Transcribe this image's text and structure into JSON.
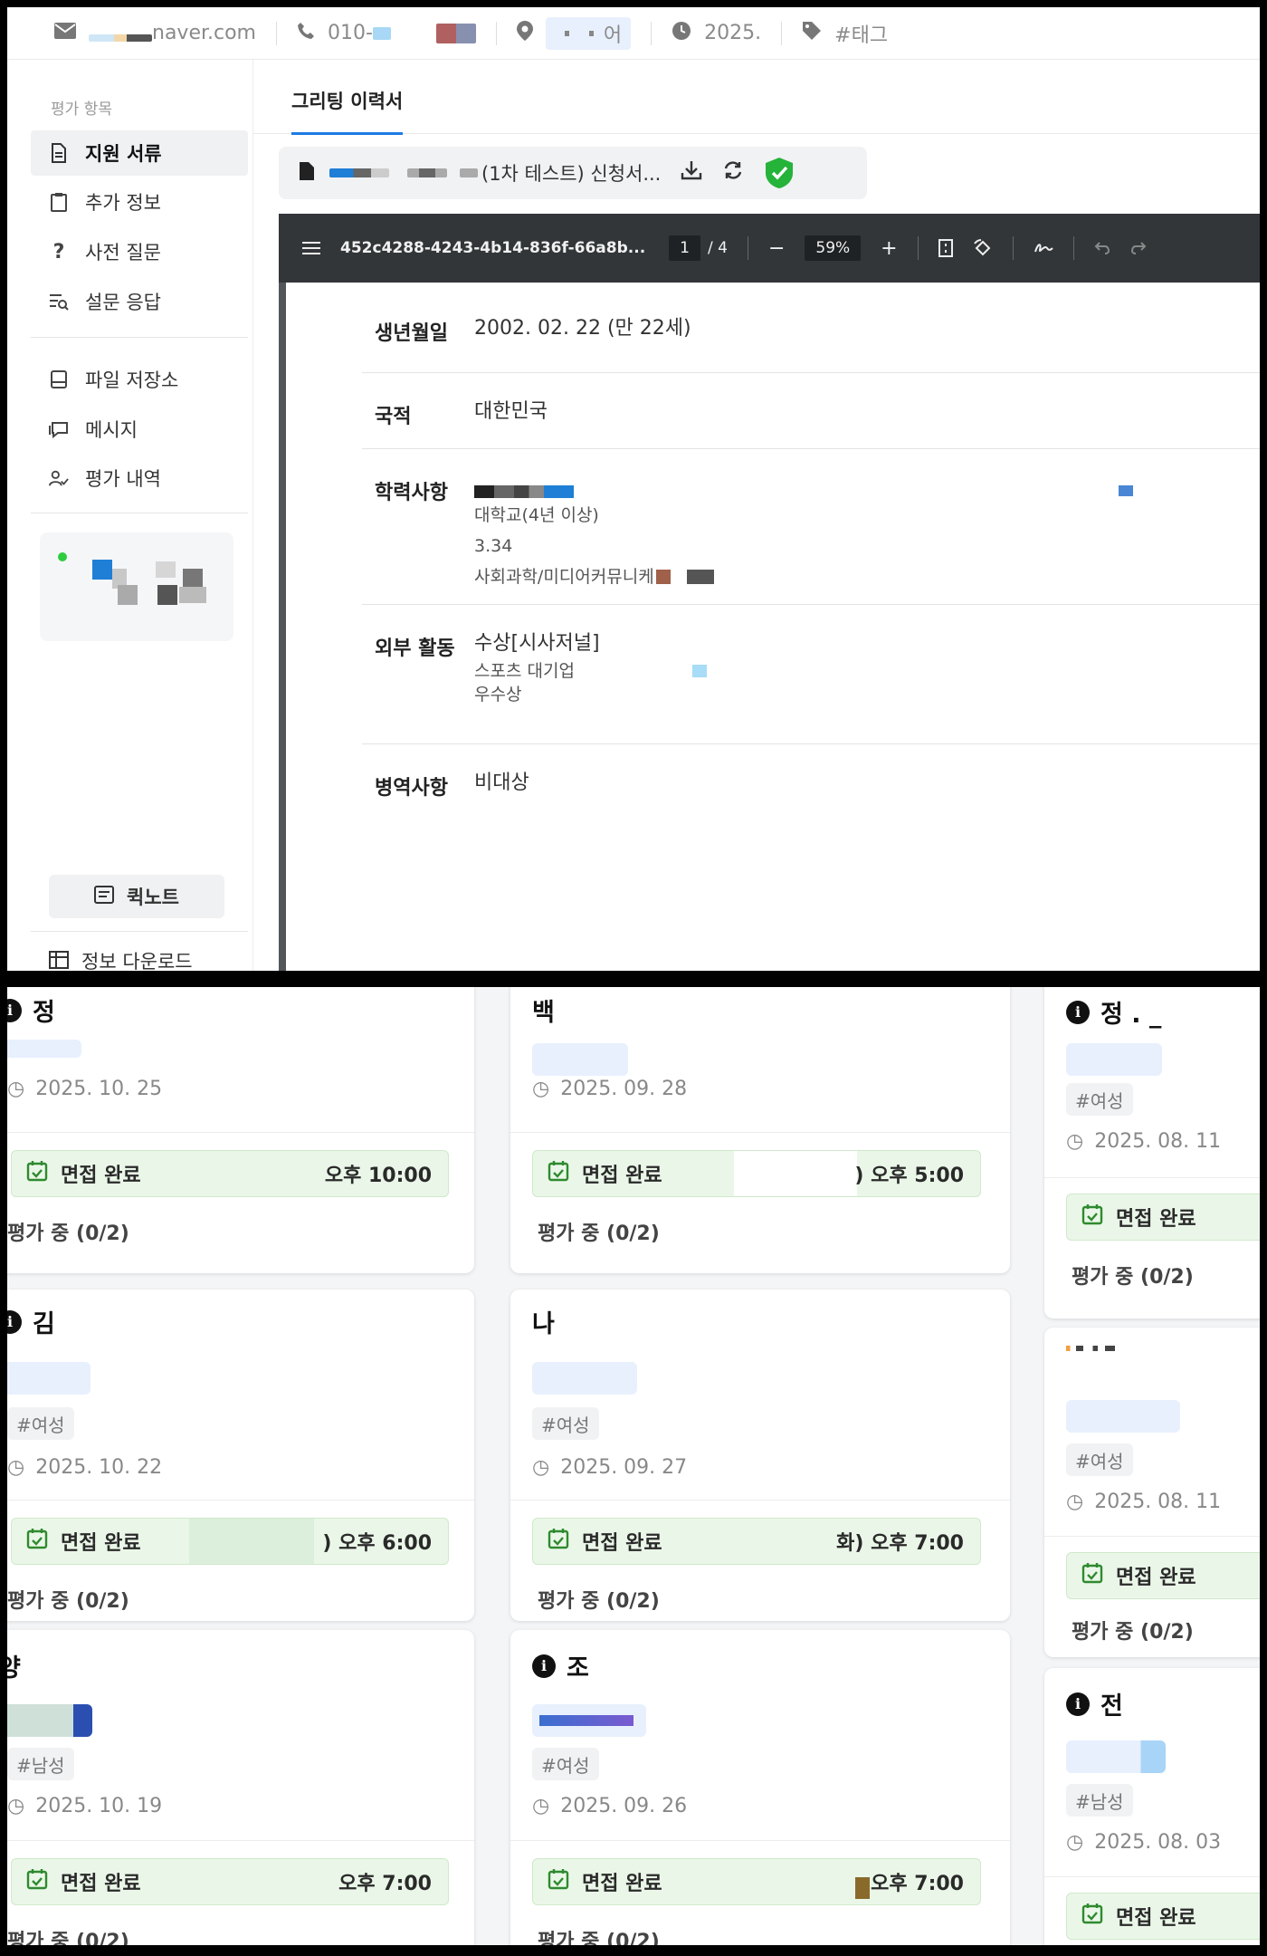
{
  "contact": {
    "email": "naver.com",
    "phone": "010-",
    "location": "어",
    "date": "2025.",
    "tag": "#태그"
  },
  "sidebar": {
    "section_title": "평가 항목",
    "items": [
      {
        "label": "지원 서류",
        "icon": "document-icon"
      },
      {
        "label": "추가 정보",
        "icon": "clipboard-icon"
      },
      {
        "label": "사전 질문",
        "icon": "question-icon"
      },
      {
        "label": "설문 응답",
        "icon": "survey-icon"
      }
    ],
    "items2": [
      {
        "label": "파일 저장소",
        "icon": "storage-icon"
      },
      {
        "label": "메시지",
        "icon": "message-icon"
      },
      {
        "label": "평가 내역",
        "icon": "user-check-icon"
      }
    ],
    "quicknote": "퀵노트",
    "download": "정보 다운로드"
  },
  "main": {
    "tab": "그리팅 이력서",
    "file_name": "(1차 테스트) 신청서...",
    "viewer": {
      "doc_id": "452c4288-4243-4b14-836f-66a8b...",
      "page": "1",
      "page_total": "/ 4",
      "zoom": "59%"
    }
  },
  "resume": {
    "birth_label": "생년월일",
    "birth_value": "2002. 02. 22 (만 22세)",
    "nation_label": "국적",
    "nation_value": "대한민국",
    "edu_label": "학력사항",
    "edu_line1": "대학교(4년 이상)",
    "edu_line2": "3.34",
    "edu_line3": "사회과학/미디어커뮤니케",
    "ext_label": "외부 활동",
    "ext_line1": "수상[시사저널]",
    "ext_line2": "스포츠 대기업",
    "ext_line3": "우수상",
    "mil_label": "병역사항",
    "mil_value": "비대상"
  },
  "cards": {
    "status_label": "면접 완료",
    "eval_label": "평가 중 (0/2)",
    "c1": {
      "name": "정",
      "date": "2025. 10. 25",
      "time": "오후 10:00"
    },
    "c2": {
      "name": "백",
      "date": "2025. 09. 28",
      "time": ") 오후 5:00"
    },
    "c3": {
      "name": "정 . _",
      "tag": "#여성",
      "date": "2025. 08. 11"
    },
    "c4": {
      "name": "김",
      "tag": "#여성",
      "date": "2025. 10. 22",
      "time": ") 오후 6:00"
    },
    "c5": {
      "name": "나",
      "tag": "#여성",
      "date": "2025. 09. 27",
      "time": "화) 오후 7:00"
    },
    "c6": {
      "tag": "#여성",
      "date": "2025. 08. 11"
    },
    "c7": {
      "name": "양",
      "tag": "#남성",
      "date": "2025. 10. 19",
      "time": "오후 7:00"
    },
    "c8": {
      "name": "조",
      "tag": "#여성",
      "date": "2025. 09. 26",
      "time": "오후 7:00"
    },
    "c9": {
      "name": "전",
      "tag": "#남성",
      "date": "2025. 08. 03"
    }
  }
}
